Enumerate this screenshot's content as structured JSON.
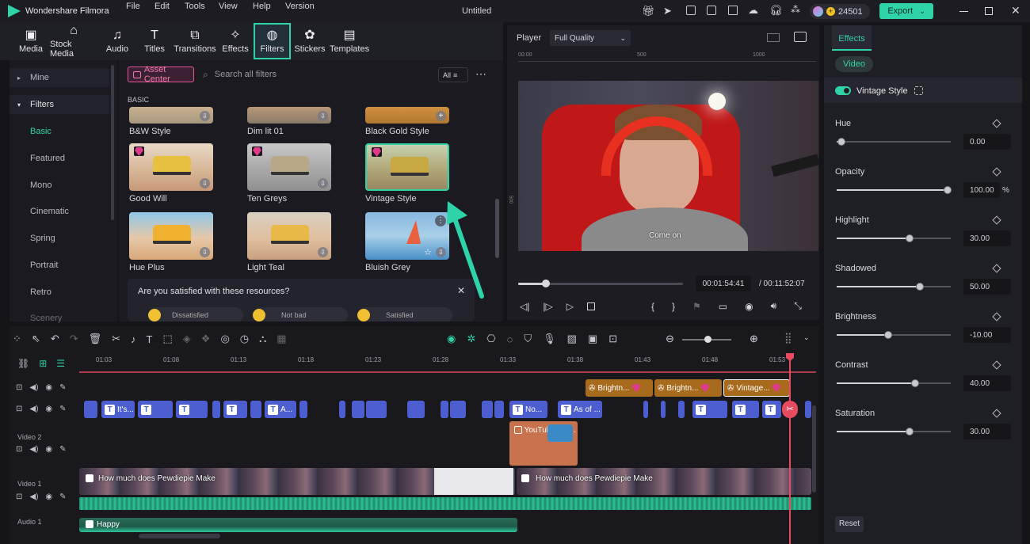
{
  "app": {
    "name": "Wondershare Filmora",
    "project_title": "Untitled",
    "credits": "24501",
    "export_label": "Export",
    "menu": [
      "File",
      "Edit",
      "Tools",
      "View",
      "Help",
      "Version"
    ]
  },
  "toolbar": {
    "items": [
      "Media",
      "Stock Media",
      "Audio",
      "Titles",
      "Transitions",
      "Effects",
      "Filters",
      "Stickers",
      "Templates"
    ],
    "active": "Filters"
  },
  "left_nav": {
    "mine": "Mine",
    "filters": "Filters",
    "items": [
      "Basic",
      "Featured",
      "Mono",
      "Cinematic",
      "Spring",
      "Portrait",
      "Retro",
      "Scenery"
    ],
    "selected": "Basic"
  },
  "assets": {
    "asset_center": "Asset Center",
    "search_placeholder": "Search all filters",
    "all_label": "All",
    "section": "BASIC",
    "row0": [
      "B&W Style",
      "Dim lit 01",
      "Black Gold Style"
    ],
    "row1": [
      "Good Will",
      "Ten Greys",
      "Vintage Style"
    ],
    "row2": [
      "Hue Plus",
      "Light Teal",
      "Bluish Grey"
    ],
    "survey": {
      "question": "Are you satisfied with these resources?",
      "options": [
        "Dissatisfied",
        "Not bad",
        "Satisfied"
      ]
    }
  },
  "player": {
    "label": "Player",
    "quality": "Full Quality",
    "ruler": [
      "00:00",
      "500",
      "1000"
    ],
    "caption": "Come on",
    "current_time": "00:01:54:41",
    "total_time": "/ 00:11:52:07",
    "progress": 0.17
  },
  "props": {
    "tab": "Effects",
    "subtab": "Video",
    "effect_name": "Vintage Style",
    "reset_label": "Reset",
    "params": [
      {
        "label": "Hue",
        "value": "0.00",
        "level": 0.04
      },
      {
        "label": "Opacity",
        "value": "100.00",
        "unit": "%",
        "level": 0.97
      },
      {
        "label": "Highlight",
        "value": "30.00",
        "level": 0.64
      },
      {
        "label": "Shadowed",
        "value": "50.00",
        "level": 0.73
      },
      {
        "label": "Brightness",
        "value": "-10.00",
        "level": 0.45
      },
      {
        "label": "Contrast",
        "value": "40.00",
        "level": 0.69
      },
      {
        "label": "Saturation",
        "value": "30.00",
        "level": 0.64
      }
    ]
  },
  "timeline": {
    "ruler": [
      "01:03",
      "01:08",
      "01:13",
      "01:18",
      "01:23",
      "01:28",
      "01:33",
      "01:38",
      "01:43",
      "01:48",
      "01:53"
    ],
    "tracks": {
      "video2": "Video 2",
      "video1": "Video 1",
      "audio1": "Audio 1"
    },
    "fx_clips": [
      "Brightn...",
      "Brightn...",
      "Vintage..."
    ],
    "title_clips": [
      "It's...",
      "A...",
      "No...",
      "As of ..."
    ],
    "overlay_clip": "YouTube Tre...",
    "video_clip_1": "How much does Pewdiepie Make",
    "video_clip_2": "How much does Pewdiepie Make",
    "audio_clip": "Happy"
  },
  "colors": {
    "accent": "#2ed3a7",
    "asset_center": "#e8569a",
    "title_clip": "#4d5fd0",
    "fx_clip": "#a86b1e",
    "playhead": "#e84a5f"
  }
}
